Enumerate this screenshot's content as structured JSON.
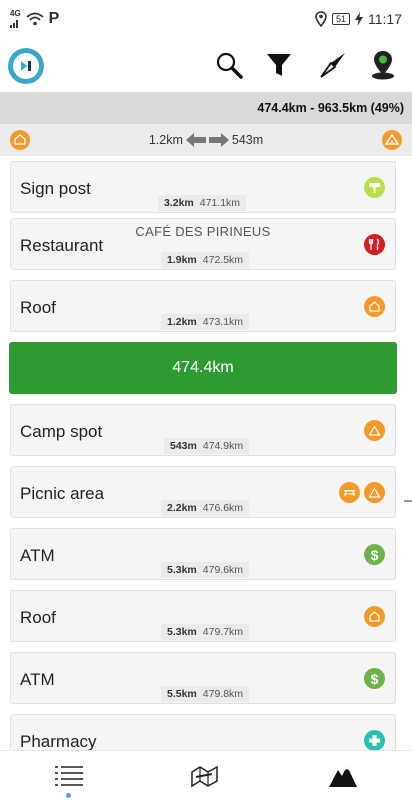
{
  "status_bar": {
    "network": "4G",
    "carrier_glyph": "P",
    "battery": "51",
    "time": "11:17"
  },
  "toolbar": {
    "icons": [
      "app-logo-icon",
      "search-icon",
      "filter-icon",
      "compass-icon",
      "map-pin-icon"
    ]
  },
  "progress": {
    "text": "474.4km - 963.5km (49%)"
  },
  "distance_row": {
    "left_text": "1.2km",
    "right_text": "543m"
  },
  "colors": {
    "orange": "#f39a2b",
    "green_banner": "#2e9b32",
    "restaurant_red": "#d62020",
    "atm_green": "#6bb34a",
    "signpost_lime": "#b8e04a",
    "pharmacy_teal": "#2bbfb0"
  },
  "current_position": {
    "label": "474.4km"
  },
  "items": [
    {
      "name": "Sign post",
      "subtitle": "",
      "dist": "3.2km",
      "km": "471.1km",
      "icons": [
        "signpost-icon"
      ]
    },
    {
      "name": "Restaurant",
      "subtitle": "CAFÉ DES PIRINEUS",
      "dist": "1.9km",
      "km": "472.5km",
      "icons": [
        "restaurant-icon"
      ]
    },
    {
      "name": "Roof",
      "subtitle": "",
      "dist": "1.2km",
      "km": "473.1km",
      "icons": [
        "roof-icon"
      ]
    },
    {
      "name": "Camp spot",
      "subtitle": "",
      "dist": "543m",
      "km": "474.9km",
      "icons": [
        "camp-icon"
      ]
    },
    {
      "name": "Picnic area",
      "subtitle": "",
      "dist": "2.2km",
      "km": "476.6km",
      "icons": [
        "picnic-table-icon",
        "camp-icon"
      ]
    },
    {
      "name": "ATM",
      "subtitle": "",
      "dist": "5.3km",
      "km": "479.6km",
      "icons": [
        "atm-icon"
      ]
    },
    {
      "name": "Roof",
      "subtitle": "",
      "dist": "5.3km",
      "km": "479.7km",
      "icons": [
        "roof-icon"
      ]
    },
    {
      "name": "ATM",
      "subtitle": "",
      "dist": "5.5km",
      "km": "479.8km",
      "icons": [
        "atm-icon"
      ]
    },
    {
      "name": "Pharmacy",
      "subtitle": "",
      "dist": "",
      "km": "",
      "icons": [
        "pharmacy-icon"
      ]
    }
  ],
  "bottom_nav": {
    "items": [
      "list-icon",
      "map-icon",
      "elevation-icon"
    ],
    "active": "list-icon"
  }
}
